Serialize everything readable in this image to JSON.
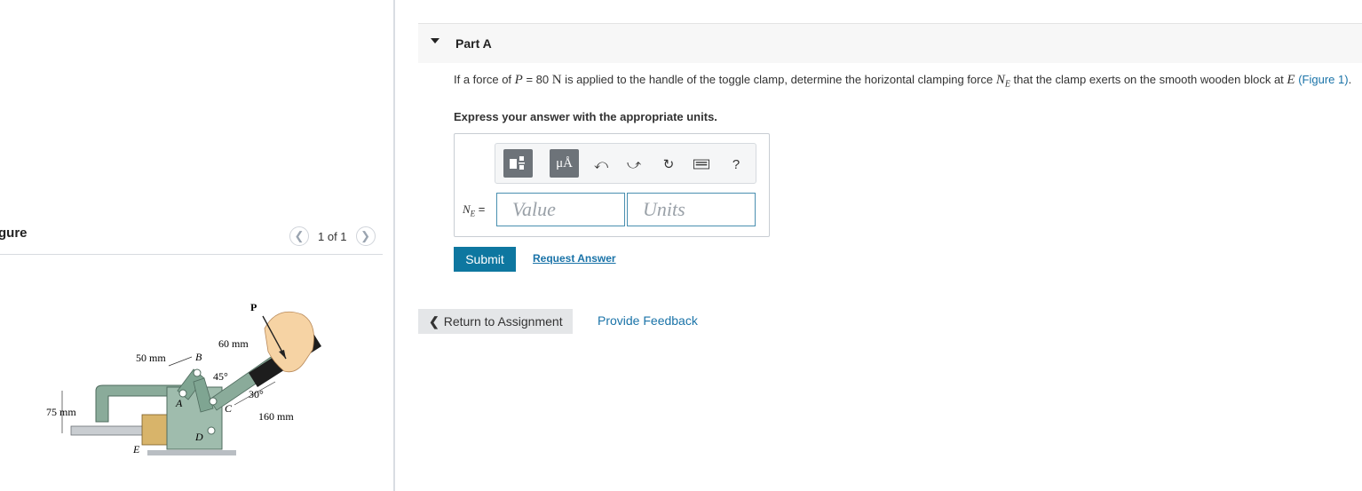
{
  "figure": {
    "title": "gure",
    "counter": "1 of 1",
    "labels": {
      "P": "P",
      "d60": "60 mm",
      "d50": "50 mm",
      "B": "B",
      "a45": "45°",
      "a30": "30°",
      "d75": "75 mm",
      "A": "A",
      "C": "C",
      "d160": "160 mm",
      "D": "D",
      "E": "E"
    }
  },
  "part": {
    "title": "Part A",
    "question": {
      "pre": "If a force of ",
      "P_var": "P",
      "eq": " = 80 ",
      "unit": "N",
      "mid": " is applied to the handle of the toggle clamp, determine the horizontal clamping force ",
      "NE_var": "N",
      "NE_sub": "E",
      "mid2": " that the clamp exerts on the smooth wooden block at ",
      "E_var": "E",
      "space": " ",
      "link": "(Figure 1)",
      "end": "."
    },
    "instruction": "Express your answer with the appropriate units.",
    "answer": {
      "label_var": "N",
      "label_sub": "E",
      "label_eq": " =",
      "value_placeholder": "Value",
      "units_placeholder": "Units",
      "toolbar": {
        "templates_icon": "templates-icon",
        "units_label": "μÅ",
        "undo_icon": "undo-icon",
        "redo_icon": "redo-icon",
        "reset_icon": "reset-icon",
        "keyboard_icon": "keyboard-icon",
        "help_label": "?"
      }
    },
    "submit_label": "Submit",
    "request_answer_label": "Request Answer"
  },
  "footer": {
    "return_label": "Return to Assignment",
    "feedback_label": "Provide Feedback"
  },
  "colors": {
    "accent": "#0e77a0",
    "link": "#1a73a8",
    "clamp_green": "#7fa592"
  }
}
